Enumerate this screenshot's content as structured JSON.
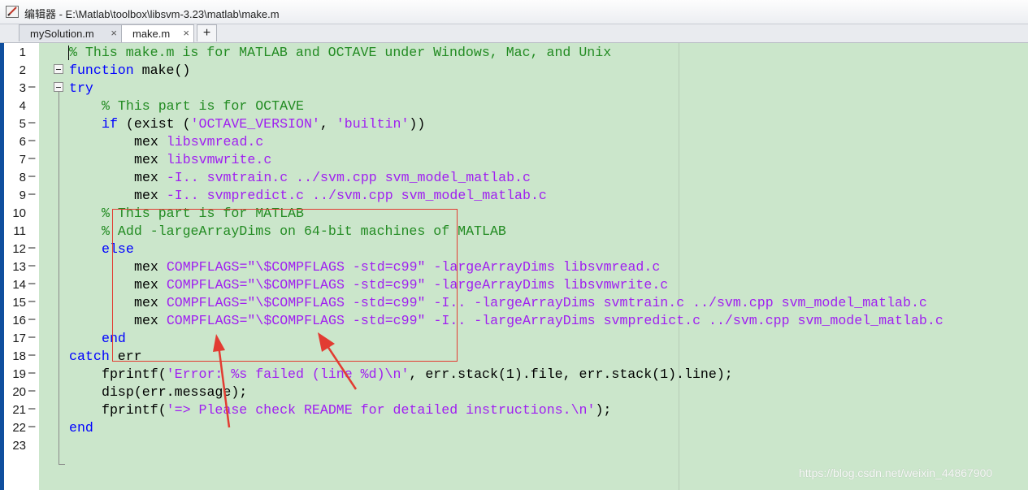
{
  "window": {
    "title": "编辑器 - E:\\Matlab\\toolbox\\libsvm-3.23\\matlab\\make.m",
    "icon": "editor-icon"
  },
  "tabs": [
    {
      "label": "mySolution.m",
      "close": "×",
      "active": false
    },
    {
      "label": "make.m",
      "close": "×",
      "active": true
    }
  ],
  "add_tab_label": "+",
  "colors": {
    "keyword": "#0000ff",
    "comment": "#228b22",
    "string": "#a020f0",
    "background": "#cbe6cb",
    "highlight_box": "#e23c32"
  },
  "lines": [
    {
      "n": "1",
      "dash": ""
    },
    {
      "n": "2",
      "dash": ""
    },
    {
      "n": "3",
      "dash": "–"
    },
    {
      "n": "4",
      "dash": ""
    },
    {
      "n": "5",
      "dash": "–"
    },
    {
      "n": "6",
      "dash": "–"
    },
    {
      "n": "7",
      "dash": "–"
    },
    {
      "n": "8",
      "dash": "–"
    },
    {
      "n": "9",
      "dash": "–"
    },
    {
      "n": "10",
      "dash": ""
    },
    {
      "n": "11",
      "dash": ""
    },
    {
      "n": "12",
      "dash": "–"
    },
    {
      "n": "13",
      "dash": "–"
    },
    {
      "n": "14",
      "dash": "–"
    },
    {
      "n": "15",
      "dash": "–"
    },
    {
      "n": "16",
      "dash": "–"
    },
    {
      "n": "17",
      "dash": "–"
    },
    {
      "n": "18",
      "dash": "–"
    },
    {
      "n": "19",
      "dash": "–"
    },
    {
      "n": "20",
      "dash": "–"
    },
    {
      "n": "21",
      "dash": "–"
    },
    {
      "n": "22",
      "dash": "–"
    },
    {
      "n": "23",
      "dash": ""
    }
  ],
  "code": {
    "l1_comment": "% This make.m is for MATLAB and OCTAVE under Windows, Mac, and Unix",
    "l2_kw": "function",
    "l2_rest": " make()",
    "l3_kw": "try",
    "l4_comment": "% This part is for OCTAVE",
    "l5_kw": "if",
    "l5_a": " (exist (",
    "l5_s1": "'OCTAVE_VERSION'",
    "l5_b": ", ",
    "l5_s2": "'builtin'",
    "l5_c": "))",
    "l6_cmd": "mex ",
    "l6_arg": "libsvmread.c",
    "l7_cmd": "mex ",
    "l7_arg": "libsvmwrite.c",
    "l8_cmd": "mex ",
    "l8_arg": "-I.. svmtrain.c ../svm.cpp svm_model_matlab.c",
    "l9_cmd": "mex ",
    "l9_arg": "-I.. svmpredict.c ../svm.cpp svm_model_matlab.c",
    "l10_comment": "% This part is for MATLAB",
    "l11_comment": "% Add -largeArrayDims on 64-bit machines of MATLAB",
    "l12_kw": "else",
    "l13_cmd": "mex ",
    "l13_arg": "COMPFLAGS=\"\\$COMPFLAGS -std=c99\" -largeArrayDims libsvmread.c",
    "l14_cmd": "mex ",
    "l14_arg": "COMPFLAGS=\"\\$COMPFLAGS -std=c99\" -largeArrayDims libsvmwrite.c",
    "l15_cmd": "mex ",
    "l15_arg": "COMPFLAGS=\"\\$COMPFLAGS -std=c99\" -I.. -largeArrayDims svmtrain.c ../svm.cpp svm_model_matlab.c",
    "l16_cmd": "mex ",
    "l16_arg": "COMPFLAGS=\"\\$COMPFLAGS -std=c99\" -I.. -largeArrayDims svmpredict.c ../svm.cpp svm_model_matlab.c",
    "l17_kw": "end",
    "l18_kw": "catch",
    "l18_rest": " err",
    "l19_a": "fprintf(",
    "l19_s": "'Error: %s failed (line %d)\\n'",
    "l19_b": ", err.stack(1).file, err.stack(1).line);",
    "l20": "disp(err.message);",
    "l21_a": "fprintf(",
    "l21_s": "'=> Please check README for detailed instructions.\\n'",
    "l21_b": ");",
    "l22_kw": "end"
  },
  "watermark": "https://blog.csdn.net/weixin_44867900"
}
